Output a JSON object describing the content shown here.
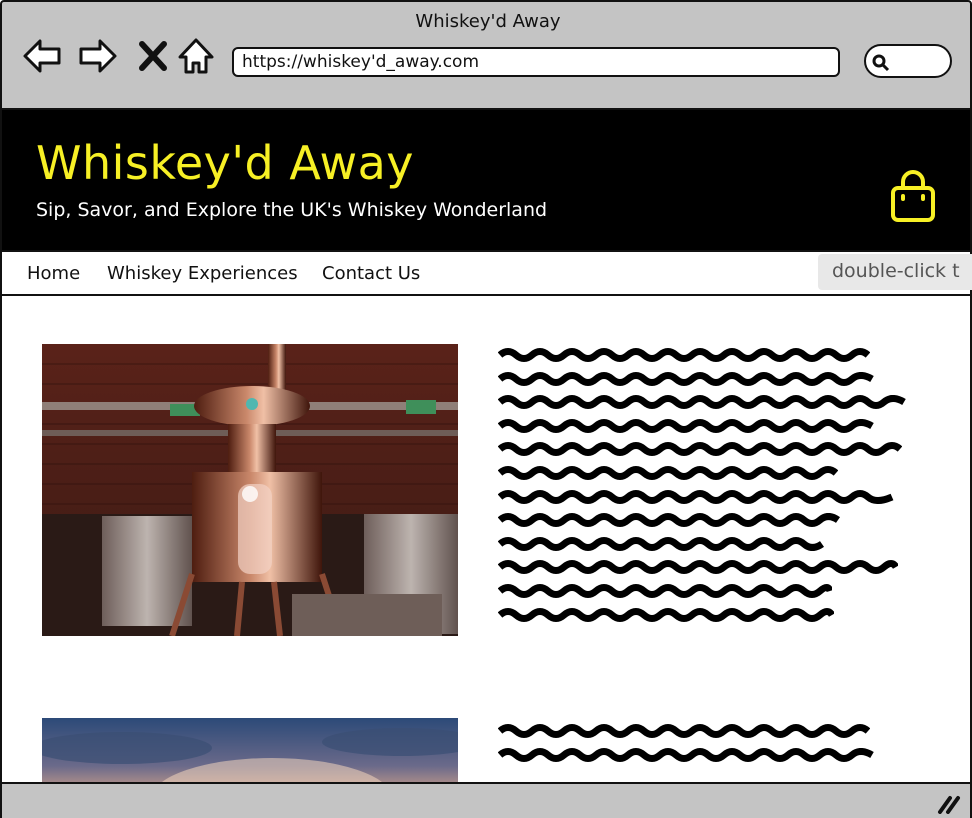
{
  "browser": {
    "window_title": "Whiskey'd Away",
    "url": "https://whiskey'd_away.com",
    "icons": [
      "back-arrow-icon",
      "forward-arrow-icon",
      "close-x-icon",
      "home-icon",
      "search-icon"
    ]
  },
  "header": {
    "title": "Whiskey'd Away",
    "tagline": "Sip, Savor, and Explore the UK's Whiskey Wonderland",
    "cart_icon": "shopping-bag-icon",
    "title_color": "#f7f025",
    "background_color": "#000000"
  },
  "nav": {
    "items": [
      {
        "label": "Home"
      },
      {
        "label": "Whiskey Experiences"
      },
      {
        "label": "Contact Us"
      }
    ],
    "tooltip": "double-click t"
  },
  "sections": [
    {
      "image": "copper-still-photo",
      "text_lines": 12
    },
    {
      "image": "sunset-sky-photo",
      "text_lines": 2
    }
  ]
}
